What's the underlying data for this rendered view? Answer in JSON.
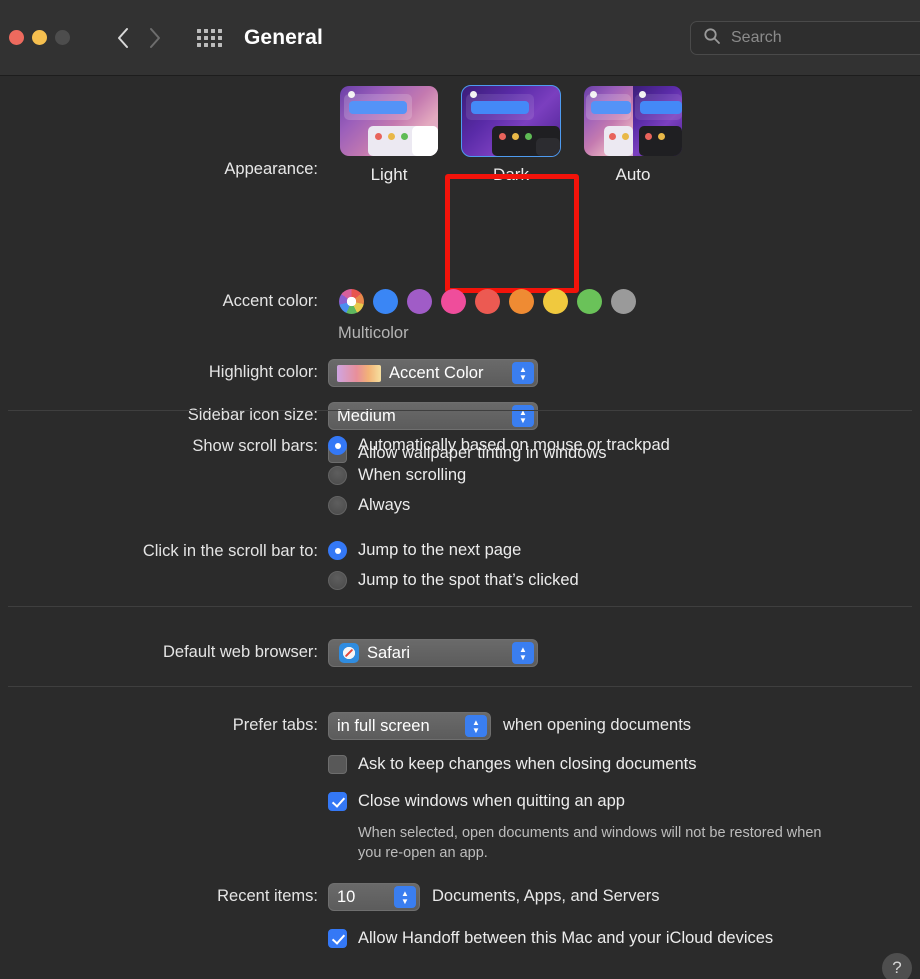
{
  "window": {
    "title": "General",
    "traffic_lights": [
      "close",
      "minimize",
      "zoom"
    ],
    "back_icon": "chevron-left-icon",
    "forward_icon": "chevron-right-icon",
    "grid_icon": "grid-view-icon"
  },
  "search": {
    "placeholder": "Search",
    "icon": "search-icon",
    "value": ""
  },
  "appearance": {
    "label": "Appearance:",
    "options": [
      {
        "id": "light",
        "label": "Light",
        "selected": false
      },
      {
        "id": "dark",
        "label": "Dark",
        "selected": true
      },
      {
        "id": "auto",
        "label": "Auto",
        "selected": false
      }
    ],
    "highlight_color": "#f3130a",
    "selection_ring_color": "#4e9bf0"
  },
  "accent": {
    "label": "Accent color:",
    "selected_label": "Multicolor",
    "swatches": [
      {
        "name": "multicolor",
        "color": "multi",
        "selected": true
      },
      {
        "name": "blue",
        "color": "#3a86f5",
        "selected": false
      },
      {
        "name": "purple",
        "color": "#a05cc7",
        "selected": false
      },
      {
        "name": "pink",
        "color": "#ef4d9b",
        "selected": false
      },
      {
        "name": "red",
        "color": "#ec5a52",
        "selected": false
      },
      {
        "name": "orange",
        "color": "#ef8b33",
        "selected": false
      },
      {
        "name": "yellow",
        "color": "#f0c93e",
        "selected": false
      },
      {
        "name": "green",
        "color": "#6ac259",
        "selected": false
      },
      {
        "name": "graphite",
        "color": "#9a9a9a",
        "selected": false
      }
    ]
  },
  "highlight": {
    "label": "Highlight color:",
    "value": "Accent Color"
  },
  "sidebar_icon_size": {
    "label": "Sidebar icon size:",
    "value": "Medium"
  },
  "wallpaper_tinting": {
    "label": "Allow wallpaper tinting in windows",
    "checked": false
  },
  "scroll_bars": {
    "label": "Show scroll bars:",
    "options": [
      {
        "label": "Automatically based on mouse or trackpad",
        "selected": true
      },
      {
        "label": "When scrolling",
        "selected": false
      },
      {
        "label": "Always",
        "selected": false
      }
    ]
  },
  "scroll_click": {
    "label": "Click in the scroll bar to:",
    "options": [
      {
        "label": "Jump to the next page",
        "selected": true
      },
      {
        "label": "Jump to the spot that’s clicked",
        "selected": false
      }
    ]
  },
  "default_browser": {
    "label": "Default web browser:",
    "value": "Safari",
    "icon": "safari-icon"
  },
  "prefer_tabs": {
    "label": "Prefer tabs:",
    "value": "in full screen",
    "suffix": "when opening documents"
  },
  "ask_keep_changes": {
    "label": "Ask to keep changes when closing documents",
    "checked": false
  },
  "close_windows": {
    "label": "Close windows when quitting an app",
    "checked": true,
    "note": "When selected, open documents and windows will not be restored when you re-open an app."
  },
  "recent_items": {
    "label": "Recent items:",
    "value": "10",
    "suffix": "Documents, Apps, and Servers"
  },
  "handoff": {
    "label": "Allow Handoff between this Mac and your iCloud devices",
    "checked": true
  },
  "help_button": {
    "label": "?"
  }
}
